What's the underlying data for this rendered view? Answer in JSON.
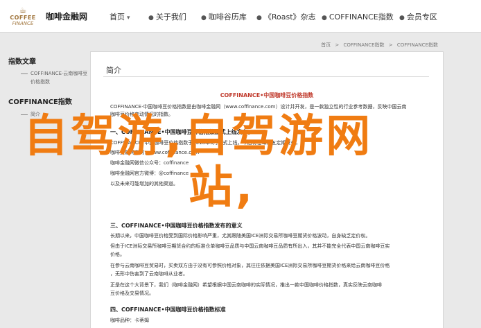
{
  "header": {
    "logo": {
      "line1": "COFFEE",
      "line2": "FINANCE"
    },
    "site_name": "咖啡金融网",
    "nav": [
      {
        "label": "首页",
        "type": "dropdown"
      },
      {
        "label": "关于我们",
        "type": "bullet"
      },
      {
        "label": "咖啡谷历库",
        "type": "bullet"
      },
      {
        "label": "《Roast》杂志",
        "type": "bullet"
      },
      {
        "label": "COFFINANCE指数",
        "type": "bullet"
      },
      {
        "label": "会员专区",
        "type": "bullet"
      }
    ]
  },
  "sidebar": {
    "groups": [
      {
        "title": "指数文章",
        "items": [
          "COFFINANCE·云南咖啡豆价格指数"
        ]
      },
      {
        "title": "COFFINANCE指数",
        "items": [
          "简介"
        ]
      }
    ]
  },
  "breadcrumb": [
    "首页",
    "COFFINANCE指数",
    "COFFINANCE指数"
  ],
  "content": {
    "tab": "简介",
    "title": "COFFINANCE•中国咖啡豆价格指数",
    "intro": [
      "COFFINANCE·中国咖啡豆价格指数是由咖啡金融网（www.coffinance.com）设计并开发，是一款独立性的行业参考数据，反映中国云南",
      "咖啡豆价格变动情况的指数。"
    ],
    "sec1": "一、COFFINANCE•中国咖啡豆价格指数正式上线发布。",
    "sec1_lines": [
      "COFFINANCE•中国咖啡豆价格指数于2018年3月正式上线，今后将在每周五定期发布，",
      "咖啡金融网官网：www.coffinance.com",
      "咖啡金融网微信公众号：coffinance",
      "咖啡金融网官方微博：@coffinance",
      "以及未来可能增加的其他渠道。"
    ],
    "sec3": "三、COFFINANCE•中国咖啡豆价格指数发布的意义",
    "sec3_lines": [
      "长期以来，中国咖啡豆价格受到国际价格影响严重，尤其跟随美国ICE洲际交易所咖啡豆期货价格波动，自身缺乏定价权。",
      "但由于ICE洲际交易所咖啡豆期货合约的标准仓单咖啡豆品质与中国云南咖啡豆品质有所出入，其并不能完全代表中国云南咖啡豆实",
      "价格。",
      "在参与云南咖啡豆贸易时，买卖双方由于没有可参照价格对象，其往往依据美国ICE洲际交易所咖啡豆期货价格来给云南咖啡豆价格",
      "，无形中伤害到了云南咖啡从业者。",
      "正是在这个大背景下，我们（咖啡金融网）希望根据中国云南咖啡的实际情况，推出一款中国咖啡价格指数，真实反映云南咖啡",
      "豆价格及交易情况。"
    ],
    "sec4": "四、COFFINANCE•中国咖啡豆价格指数标准",
    "sec4_lines": [
      "咖啡品种：卡蒂姆"
    ]
  },
  "overlay": {
    "line1": "自驾游,自驾游网",
    "line2": "站,"
  }
}
